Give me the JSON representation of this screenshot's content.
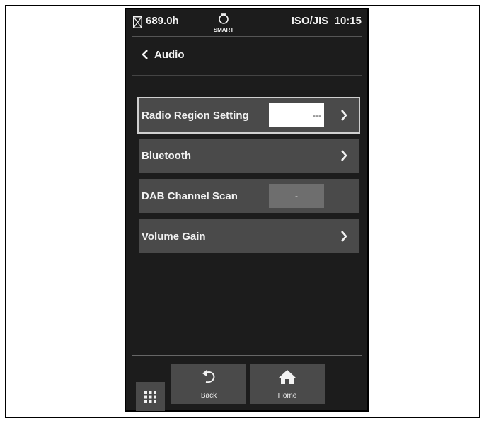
{
  "status": {
    "hours": "689.0h",
    "smart_label": "SMART",
    "standard_time": "ISO/JIS  10:15",
    "icons": [
      "hourglass-icon",
      "lightbulb-icon"
    ]
  },
  "header": {
    "title": "Audio",
    "back_icon": "chevron-left-icon"
  },
  "menu": {
    "items": [
      {
        "label": "Radio Region Setting",
        "value": "---",
        "chevron": true
      },
      {
        "label": "Bluetooth",
        "chevron": true
      },
      {
        "label": "DAB Channel Scan",
        "value": "-",
        "chevron": false
      },
      {
        "label": "Volume Gain",
        "chevron": true
      }
    ]
  },
  "footer": {
    "back_label": "Back",
    "home_label": "Home",
    "icons": [
      "undo-arrow-icon",
      "home-icon",
      "grid-icon"
    ]
  }
}
